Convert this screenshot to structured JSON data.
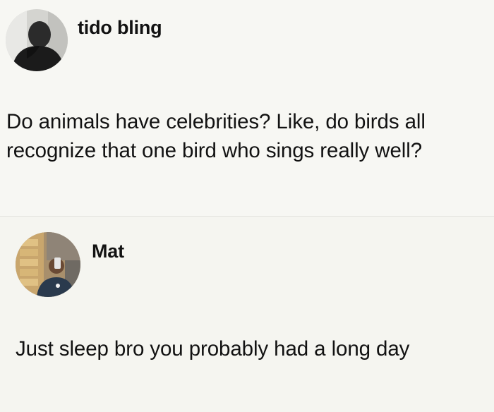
{
  "posts": [
    {
      "username": "tido bling",
      "avatar_icon": "user-avatar-dark-hoodie",
      "text": "Do animals have celebrities? Like, do birds all recognize that one bird who sings really well?"
    },
    {
      "username": "Mat",
      "avatar_icon": "user-avatar-mirror-selfie",
      "text": "Just sleep bro you probably had a long day"
    }
  ],
  "colors": {
    "background": "#f6f6f2",
    "text": "#121212",
    "divider": "#e3e3de"
  }
}
